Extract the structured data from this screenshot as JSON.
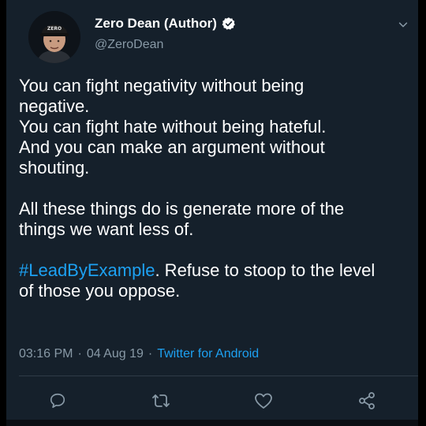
{
  "author": {
    "display_name": "Zero Dean (Author)",
    "handle": "@ZeroDean",
    "avatar_cap_text": "ZERO",
    "verified": true
  },
  "tweet": {
    "lines": [
      "You can fight negativity without being",
      "negative.",
      "You can fight hate without being hateful.",
      "And you can make an argument without",
      "shouting."
    ],
    "lines2": [
      "All these things do is generate more of the",
      "things we want less of."
    ],
    "hashtag": "#LeadByExample",
    "after_hashtag": ". Refuse to stoop to the level",
    "last_line": "of those you oppose."
  },
  "meta": {
    "time": "03:16 PM",
    "sep": "·",
    "date": "04 Aug 19",
    "source": "Twitter for Android"
  },
  "actions": {
    "reply": "reply-icon",
    "retweet": "retweet-icon",
    "like": "heart-icon",
    "share": "share-icon"
  },
  "colors": {
    "background": "#15202b",
    "text": "#ffffff",
    "muted": "#8899a6",
    "accent": "#1da1f2"
  }
}
